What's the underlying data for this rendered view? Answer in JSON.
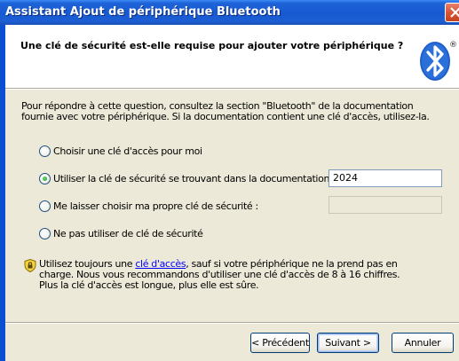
{
  "window": {
    "title": "Assistant Ajout de périphérique Bluetooth"
  },
  "header": {
    "question": "Une clé de sécurité est-elle requise pour ajouter votre périphérique ?",
    "logo_icon": "bluetooth-logo-icon",
    "logo_mark": "®"
  },
  "body": {
    "description": "Pour répondre à cette question, consultez la section \"Bluetooth\" de la documentation fournie avec votre périphérique. Si la documentation contient une clé d'accès, utilisez-la.",
    "options": [
      {
        "label": "Choisir une clé d'accès pour moi",
        "selected": false
      },
      {
        "label": "Utiliser la clé de sécurité se trouvant dans la documentation :",
        "selected": true
      },
      {
        "label": "Me laisser choisir ma propre clé de sécurité :",
        "selected": false
      },
      {
        "label": "Ne pas utiliser de clé de sécurité",
        "selected": false
      }
    ],
    "doc_key_value": "2024",
    "own_key_value": "",
    "note": {
      "icon": "security-shield-icon",
      "before_link": "Utilisez toujours une ",
      "link": "clé d'accès",
      "after_link": ", sauf si votre périphérique ne la prend pas en charge. Nous vous recommandons d'utiliser une clé d'accès de 8 à 16 chiffres. Plus la clé d'accès est longue, plus elle est sûre."
    }
  },
  "buttons": {
    "back": "< Précédent",
    "next": "Suivant >",
    "cancel": "Annuler"
  }
}
